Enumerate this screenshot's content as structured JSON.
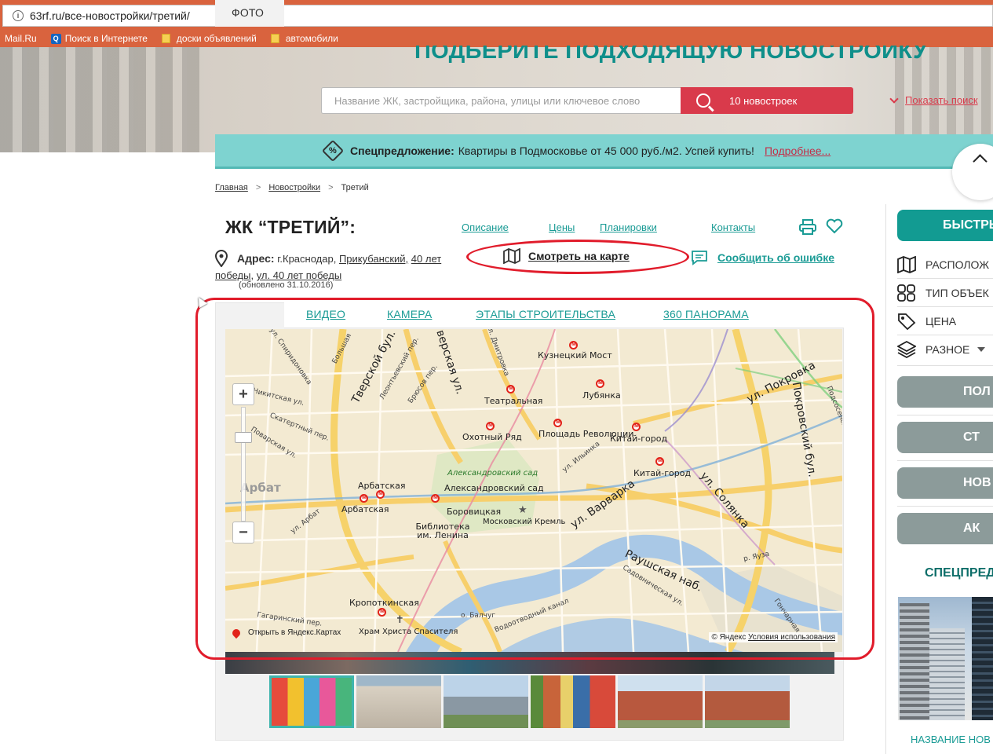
{
  "browser": {
    "url": "63rf.ru/все-новостройки/третий/",
    "bookmarks": [
      "Mail.Ru",
      "Поиск в Интернете",
      "доски объявлений",
      "автомобили"
    ]
  },
  "hero": {
    "title": "ПОДБЕРИТЕ ПОДХОДЯЩУЮ НОВОСТРОЙКУ",
    "search_placeholder": "Название ЖК, застройщика, района, улицы или ключевое слово",
    "search_button": "10 новостроек",
    "show_search": "Показать поиск"
  },
  "promo": {
    "bold": "Спецпредложение:",
    "text": "Квартиры в Подмосковье от 45 000 руб./м2. Успей купить!",
    "more": "Подробнее..."
  },
  "breadcrumb": [
    "Главная",
    "Новостройки",
    "Третий"
  ],
  "complex": {
    "title": "ЖК “ТРЕТИЙ”:",
    "nav": [
      "Описание",
      "Цены",
      "Планировки",
      "Контакты"
    ],
    "address_label": "Адрес:",
    "address_city": "г.Краснодар,",
    "address_district": "Прикубанский,",
    "address_street1": "40 лет победы,",
    "address_street2": "ул. 40 лет победы",
    "updated": "(обновлено 31.10.2016)",
    "map_button": "Смотреть на карте",
    "report_error": "Сообщить об ошибке"
  },
  "media_tabs": [
    "ФОТО",
    "ВИДЕО",
    "КАМЕРА",
    "ЭТАПЫ СТРОИТЕЛЬСТВА",
    "360 ПАНОРАМА"
  ],
  "map": {
    "open_link": "Открыть в Яндекс.Картах",
    "copyright": "© Яндекс",
    "terms": "Условия использования",
    "stations": [
      "Кузнецкий Мост",
      "Театральная",
      "Лубянка",
      "Охотный Ряд",
      "Площадь Революции",
      "Китай-город",
      "Китай-город",
      "Арбатская",
      "Арбатская",
      "Боровицкая",
      "Библиотека им. Ленина",
      "Кропоткинская"
    ],
    "places": [
      "Александровский сад",
      "Александровский сад",
      "Московский Кремль",
      "Храм Христа Спасителя",
      "Арбат",
      "о. Балчуг"
    ],
    "streets": [
      "ул. Спиридоновка",
      "Тверской бул.",
      "Тверская ул.",
      "ул. Покровка",
      "Покровский бул.",
      "ул. Варварка",
      "ул. Солянка",
      "Раушская наб.",
      "Садовническая ул.",
      "Водоотводный канал",
      "Никитская ул.",
      "Поварская ул.",
      "Скатертный пер.",
      "Леонтьевский пер.",
      "Брюсов пер.",
      "ул. Ильинка",
      "ул. Арбат",
      "Гагаринский пер.",
      "Большая",
      "Подсосенский пер.",
      "р. Яуза",
      "Гончарная",
      "ул. Дмитровка"
    ]
  },
  "sidebar": {
    "quick": "БЫСТРЫЙ",
    "filters": [
      "РАСПОЛОЖ",
      "ТИП ОБЪЕК",
      "ЦЕНА",
      "РАЗНОЕ"
    ],
    "buttons": [
      "ПОЛ",
      "СТ",
      "НОВ",
      "АК"
    ],
    "special_head": "СПЕЦПРЕД",
    "special_name": "НАЗВАНИЕ НОВ"
  },
  "colors": {
    "teal": "#1a9b95",
    "red": "#d93a4b",
    "promo": "#7ed3d0",
    "chrome": "#d9633e"
  }
}
